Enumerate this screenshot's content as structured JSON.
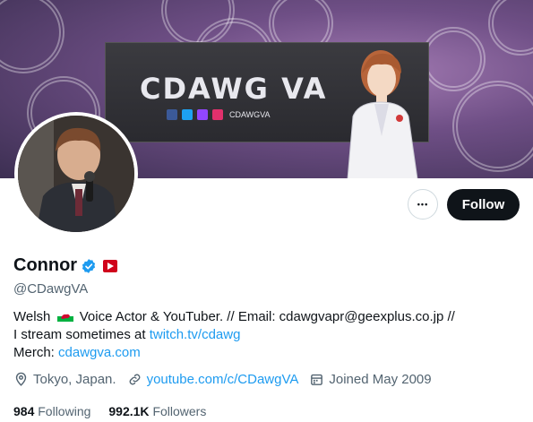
{
  "banner": {
    "brand_text": "CDAWG VA",
    "social_handle": "CDAWGVA",
    "colors": {
      "facebook": "#3b5998",
      "twitter": "#1da1f2",
      "twitch": "#9146ff",
      "instagram": "#e1306c"
    }
  },
  "actions": {
    "more_label": "•••",
    "follow_label": "Follow"
  },
  "profile": {
    "name": "Connor",
    "handle": "@CDawgVA",
    "bio": {
      "line1_a": "Welsh",
      "line1_b": "Voice Actor & YouTuber.  // Email:  cdawgvapr@geexplus.co.jp //",
      "line2_a": "I stream sometimes at ",
      "line2_link": "twitch.tv/cdawg",
      "line3_a": "Merch: ",
      "line3_link": "cdawgva.com"
    },
    "location": "Tokyo, Japan.",
    "website": "youtube.com/c/CDawgVA",
    "joined": "Joined May 2009"
  },
  "stats": {
    "following_count": "984",
    "following_label": "Following",
    "followers_count": "992.1K",
    "followers_label": "Followers"
  },
  "colors": {
    "accent": "#1d9bf0",
    "muted": "#536471",
    "text": "#0f1419"
  }
}
